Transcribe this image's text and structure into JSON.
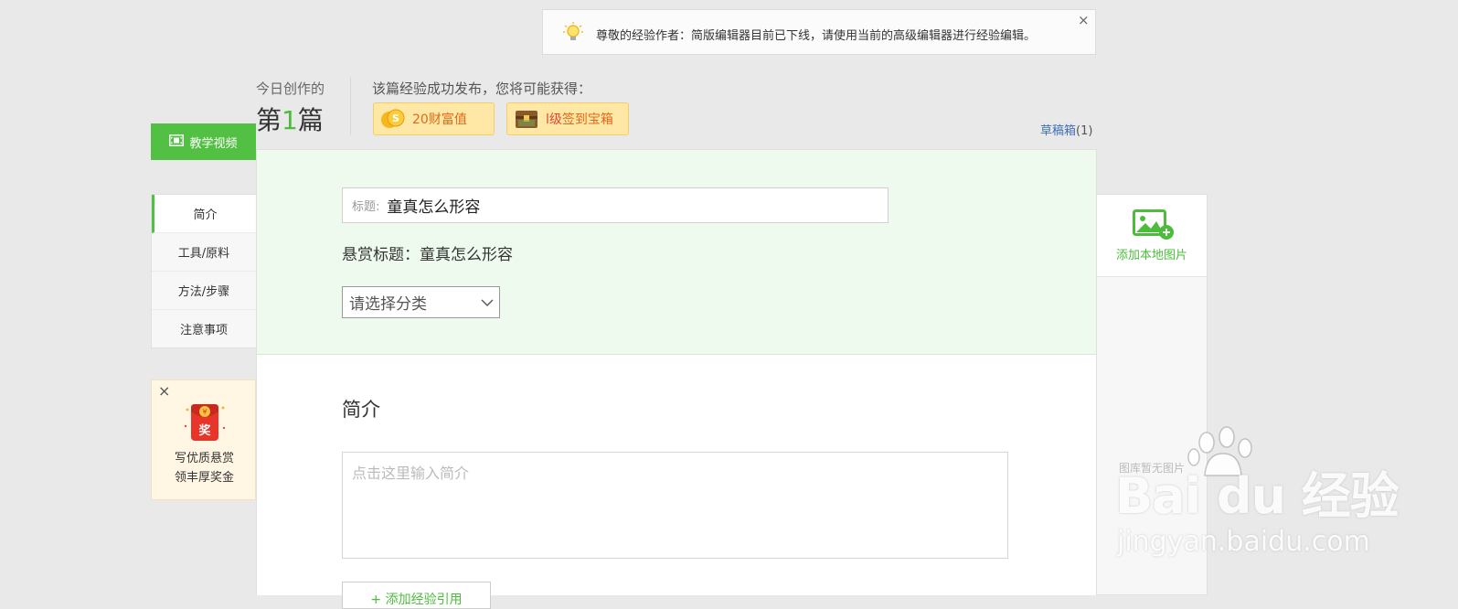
{
  "notice": {
    "text": "尊敬的经验作者：简版编辑器目前已下线，请使用当前的高级编辑器进行经验编辑。",
    "close": "×"
  },
  "header": {
    "today_label": "今日创作的",
    "today_prefix": "第",
    "today_number": "1",
    "today_suffix": "篇",
    "rewards_label": "该篇经验成功发布，您将可能获得：",
    "reward_wealth": "20财富值",
    "reward_box_level": "l级",
    "reward_box_label": "签到宝箱",
    "draft_label": "草稿箱",
    "draft_count": "(1)"
  },
  "sidebar": {
    "video_button": "教学视频",
    "nav_items": [
      {
        "label": "简介"
      },
      {
        "label": "工具/原料"
      },
      {
        "label": "方法/步骤"
      },
      {
        "label": "注意事项"
      }
    ],
    "promo_close": "×",
    "promo_badge": "奖",
    "promo_line1": "写优质悬赏",
    "promo_line2": "领丰厚奖金"
  },
  "form": {
    "title_placeholder": "标题:",
    "title_value": "童真怎么形容",
    "bounty_title": "悬赏标题：童真怎么形容",
    "category_select": "请选择分类",
    "intro_heading": "简介",
    "intro_placeholder": "点击这里输入简介",
    "add_reference": "+ 添加经验引用"
  },
  "right_panel": {
    "add_image": "添加本地图片",
    "no_image": "图库暂无图片"
  },
  "watermark": {
    "brand": "Bai  du 经验",
    "url": "jingyan.baidu.com"
  },
  "colors": {
    "accent_green": "#52c042",
    "link_blue": "#3f6fb6",
    "reward_orange": "#e0691a"
  }
}
